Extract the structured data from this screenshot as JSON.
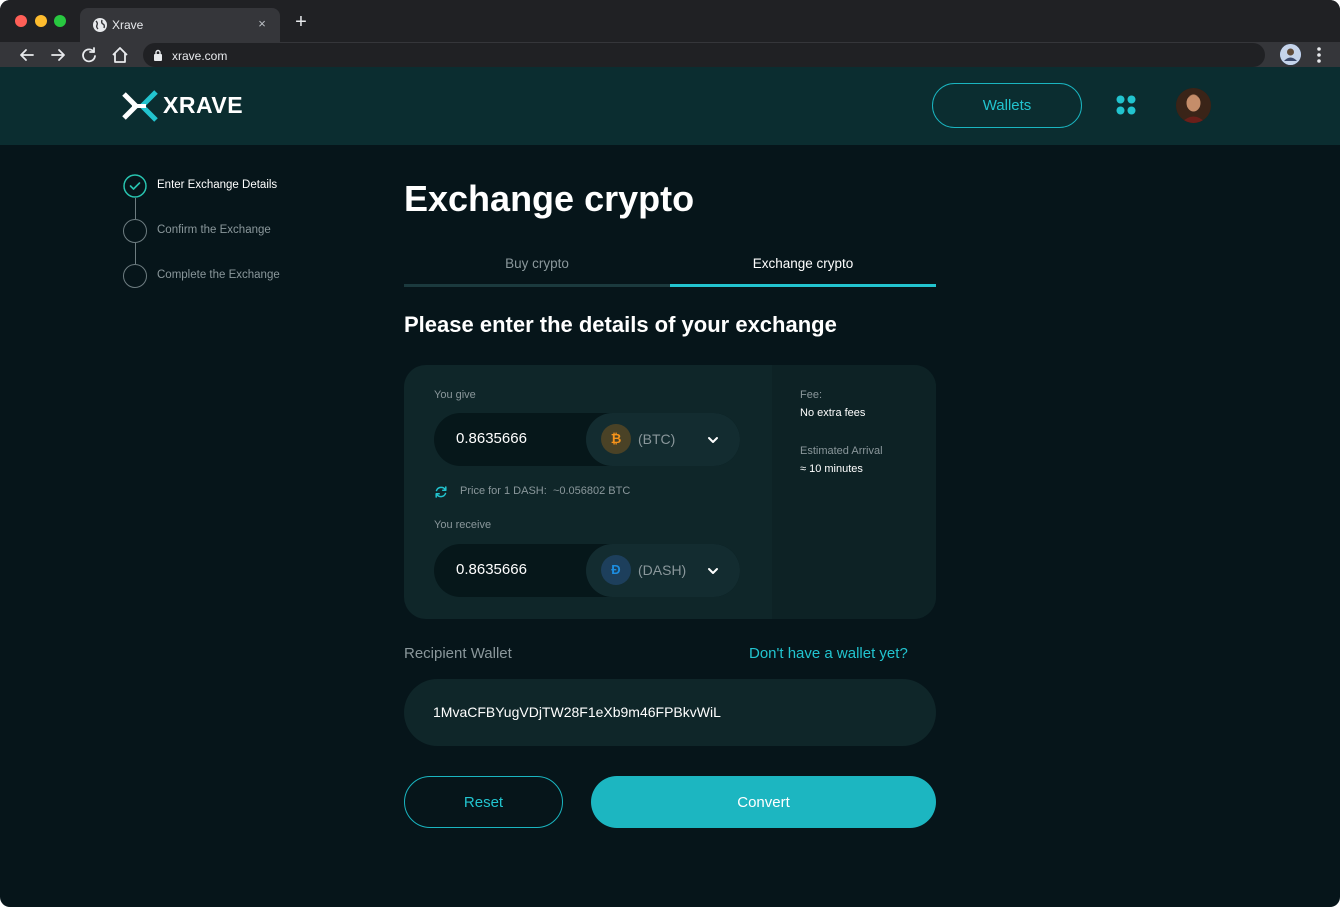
{
  "browser": {
    "tab_title": "Xrave",
    "tab_close": "×",
    "new_tab": "+",
    "url": "xrave.com",
    "traffic_lights": {
      "close": "#ff5f57",
      "minimize": "#febc2e",
      "zoom": "#28c840"
    }
  },
  "header": {
    "logo_text": "XRAVE",
    "wallets_label": "Wallets"
  },
  "steps": [
    {
      "label": "Enter Exchange Details",
      "state": "completed"
    },
    {
      "label": "Confirm the Exchange",
      "state": "pending"
    },
    {
      "label": "Complete the Exchange",
      "state": "pending"
    }
  ],
  "main": {
    "title": "Exchange crypto",
    "tabs": [
      {
        "label": "Buy crypto",
        "active": false
      },
      {
        "label": "Exchange crypto",
        "active": true
      }
    ],
    "section_title": "Please enter the details of your exchange"
  },
  "exchange": {
    "give": {
      "label": "You give",
      "amount": "0.8635666",
      "currency_code": "(BTC)",
      "coin_glyph": "₿",
      "coin_icon": "bitcoin-icon"
    },
    "rate": {
      "label": "Price for 1 DASH:",
      "value": "~0.056802 BTC"
    },
    "receive": {
      "label": "You receive",
      "amount": "0.8635666",
      "currency_code": "(DASH)",
      "coin_glyph": "Đ",
      "coin_icon": "dash-icon"
    },
    "fee_label": "Fee:",
    "fee_value": "No extra fees",
    "arrival_label": "Estimated Arrival",
    "arrival_value": "≈ 10 minutes"
  },
  "recipient": {
    "label": "Recipient Wallet",
    "link": "Don't have a wallet yet?",
    "address": "1MvaCFBYugVDjTW28F1eXb9m46FPBkvWiL"
  },
  "actions": {
    "reset_label": "Reset",
    "convert_label": "Convert"
  },
  "colors": {
    "accent": "#1cb6c1",
    "background": "#06151a",
    "header_bg": "#0b2d30",
    "card_bg": "#0f2629",
    "step_done": "#28c4b0"
  }
}
